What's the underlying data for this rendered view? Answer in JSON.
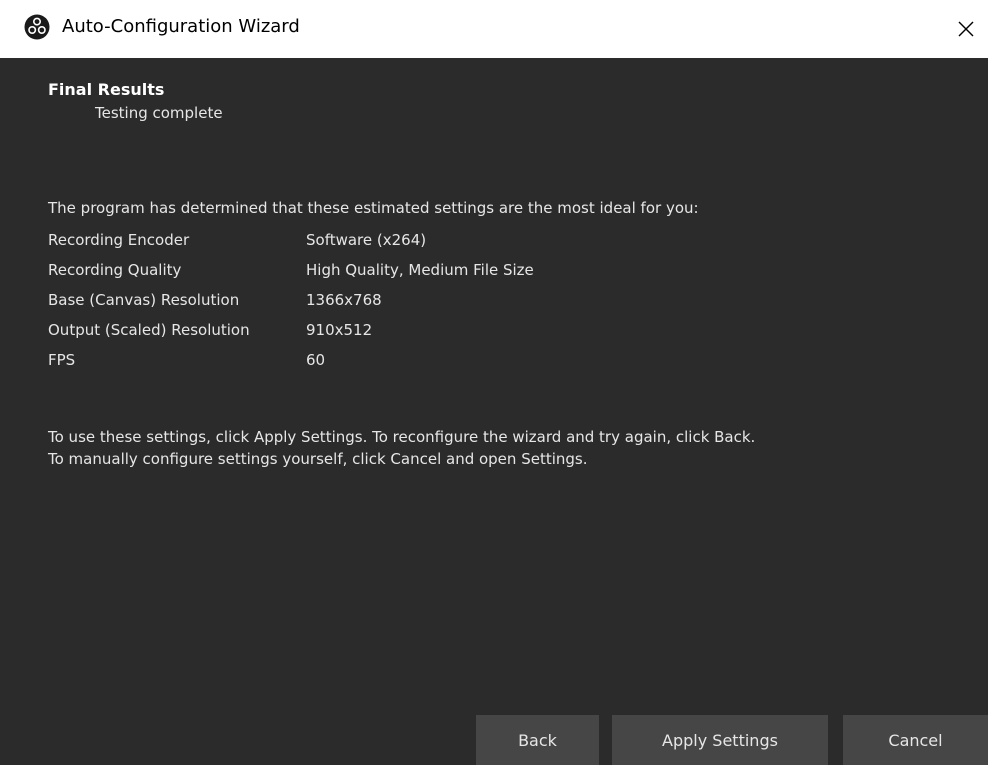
{
  "window": {
    "title": "Auto-Configuration Wizard",
    "icon": "obs-logo-icon",
    "close_icon": "close-icon"
  },
  "page": {
    "title": "Final Results",
    "subtitle": "Testing complete"
  },
  "intro": "The program has determined that these estimated settings are the most ideal for you:",
  "settings": [
    {
      "label": "Recording Encoder",
      "value": "Software (x264)"
    },
    {
      "label": "Recording Quality",
      "value": "High Quality, Medium File Size"
    },
    {
      "label": "Base (Canvas) Resolution",
      "value": "1366x768"
    },
    {
      "label": "Output (Scaled) Resolution",
      "value": "910x512"
    },
    {
      "label": "FPS",
      "value": "60"
    }
  ],
  "note": {
    "line1": "To use these settings, click Apply Settings. To reconfigure the wizard and try again, click Back.",
    "line2": "To manually configure settings yourself, click Cancel and open Settings."
  },
  "buttons": {
    "back": "Back",
    "apply": "Apply Settings",
    "cancel": "Cancel"
  },
  "colors": {
    "background": "#2b2b2b",
    "button": "#464646",
    "text": "#e6e6e6",
    "titlebar": "#ffffff"
  }
}
